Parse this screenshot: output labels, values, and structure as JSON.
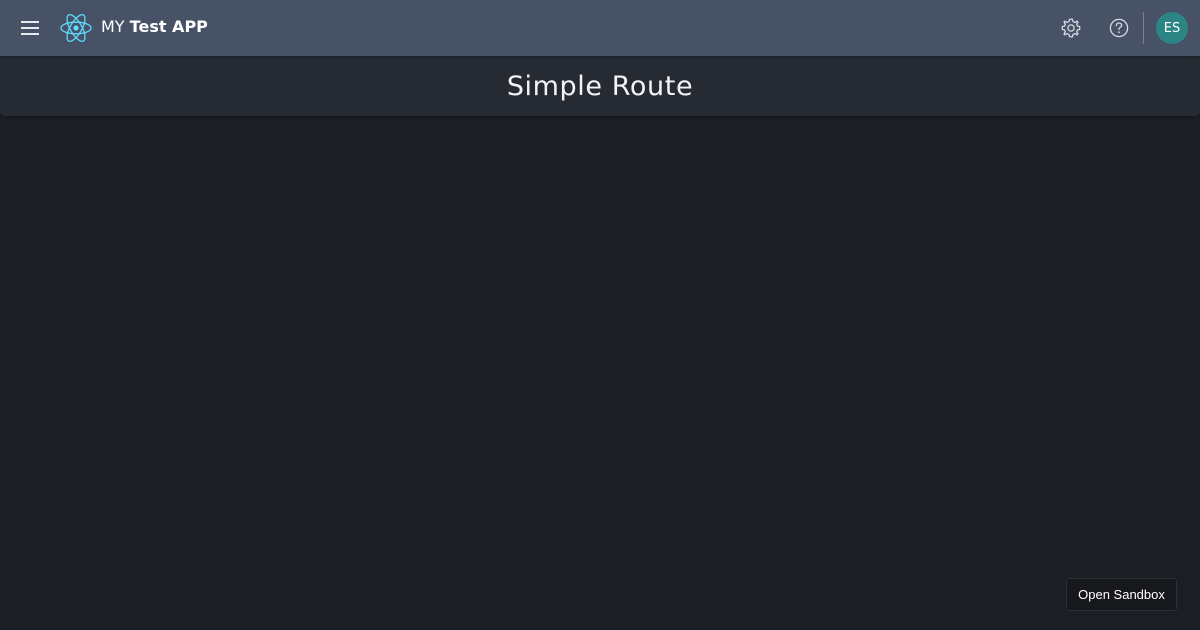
{
  "header": {
    "title_prefix": "MY",
    "title_main": "Test APP",
    "avatar_initials": "ES",
    "icons": {
      "menu": "hamburger-menu-icon",
      "logo": "react-atom-logo",
      "settings": "gear-icon",
      "help": "help-circle-icon"
    }
  },
  "page": {
    "title": "Simple Route"
  },
  "sandbox": {
    "label": "Open Sandbox"
  },
  "colors": {
    "topbar": "#475267",
    "page_header": "#252a33",
    "background": "#1b1e24",
    "logo_accent": "#61dafb",
    "avatar": "#2b8585"
  }
}
